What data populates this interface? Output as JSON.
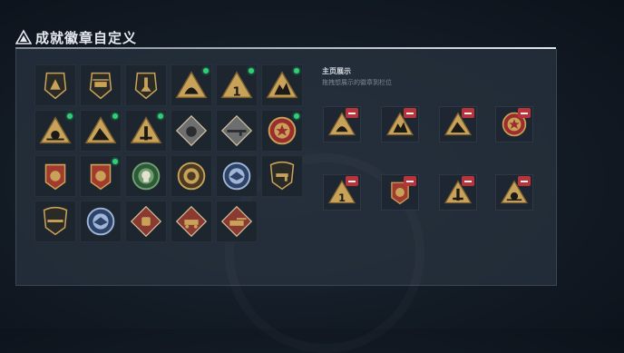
{
  "header": {
    "title": "成就徽章自定义",
    "icon": "warning-triangle-icon"
  },
  "badge_grid": {
    "badges": [
      {
        "icon": "pyramid-shield-badge-icon",
        "new": false
      },
      {
        "icon": "helicopter-shield-badge-icon",
        "new": false
      },
      {
        "icon": "rocket-shield-badge-icon",
        "new": false
      },
      {
        "icon": "dome-triangle-badge-icon",
        "new": true
      },
      {
        "icon": "number-one-triangle-badge-icon",
        "new": true
      },
      {
        "icon": "twin-peaks-triangle-badge-icon",
        "new": true
      },
      {
        "icon": "sunburst-triangle-badge-icon",
        "new": true
      },
      {
        "icon": "mountain-triangle-badge-icon",
        "new": true
      },
      {
        "icon": "tower-triangle-badge-icon",
        "new": true
      },
      {
        "icon": "grenade-diamond-badge-icon",
        "new": false
      },
      {
        "icon": "rifle-diamond-badge-icon",
        "new": false
      },
      {
        "icon": "star-crest-badge-icon",
        "new": true
      },
      {
        "icon": "sun-red-crest-badge-icon",
        "new": false
      },
      {
        "icon": "sun-red-crest-badge-icon",
        "new": true
      },
      {
        "icon": "skull-medal-badge-icon",
        "new": false
      },
      {
        "icon": "wreath-medal-badge-icon",
        "new": false
      },
      {
        "icon": "eagle-blue-crest-badge-icon",
        "new": false
      },
      {
        "icon": "pistol-shield-badge-icon",
        "new": false
      },
      {
        "icon": "rifle-shield-badge-icon",
        "new": false
      },
      {
        "icon": "eagle-blue-crest-badge-icon",
        "new": false
      },
      {
        "icon": "fist-red-diamond-badge-icon",
        "new": false
      },
      {
        "icon": "vehicle-red-diamond-badge-icon",
        "new": false
      },
      {
        "icon": "tank-red-diamond-badge-icon",
        "new": false
      }
    ]
  },
  "showcase": {
    "title": "主页展示",
    "subtitle": "拖拽想展示的徽章到栏位",
    "slots": [
      {
        "icon": "dome-triangle-badge-icon"
      },
      {
        "icon": "twin-peaks-triangle-badge-icon"
      },
      {
        "icon": "mountain-triangle-badge-icon"
      },
      {
        "icon": "star-crest-badge-icon"
      },
      {
        "icon": "number-one-triangle-badge-icon"
      },
      {
        "icon": "sun-red-crest-badge-icon"
      },
      {
        "icon": "tower-triangle-badge-icon"
      },
      {
        "icon": "sunburst-triangle-badge-icon"
      }
    ]
  },
  "colors": {
    "accent_green": "#2ecf76",
    "remove_red": "#b8343a",
    "gold": "#c9a25a"
  }
}
